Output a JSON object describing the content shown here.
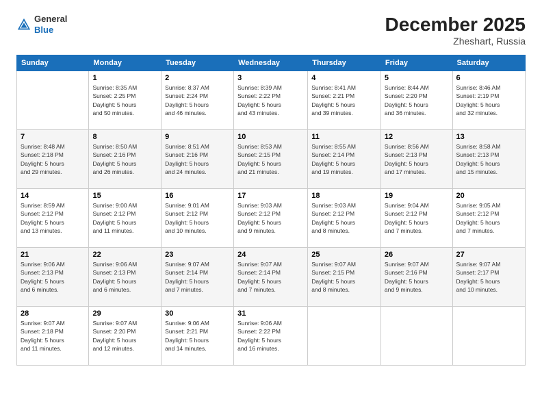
{
  "header": {
    "logo_general": "General",
    "logo_blue": "Blue",
    "month": "December 2025",
    "location": "Zheshart, Russia"
  },
  "days_of_week": [
    "Sunday",
    "Monday",
    "Tuesday",
    "Wednesday",
    "Thursday",
    "Friday",
    "Saturday"
  ],
  "weeks": [
    [
      {
        "day": "",
        "info": ""
      },
      {
        "day": "1",
        "info": "Sunrise: 8:35 AM\nSunset: 2:25 PM\nDaylight: 5 hours\nand 50 minutes."
      },
      {
        "day": "2",
        "info": "Sunrise: 8:37 AM\nSunset: 2:24 PM\nDaylight: 5 hours\nand 46 minutes."
      },
      {
        "day": "3",
        "info": "Sunrise: 8:39 AM\nSunset: 2:22 PM\nDaylight: 5 hours\nand 43 minutes."
      },
      {
        "day": "4",
        "info": "Sunrise: 8:41 AM\nSunset: 2:21 PM\nDaylight: 5 hours\nand 39 minutes."
      },
      {
        "day": "5",
        "info": "Sunrise: 8:44 AM\nSunset: 2:20 PM\nDaylight: 5 hours\nand 36 minutes."
      },
      {
        "day": "6",
        "info": "Sunrise: 8:46 AM\nSunset: 2:19 PM\nDaylight: 5 hours\nand 32 minutes."
      }
    ],
    [
      {
        "day": "7",
        "info": "Sunrise: 8:48 AM\nSunset: 2:18 PM\nDaylight: 5 hours\nand 29 minutes."
      },
      {
        "day": "8",
        "info": "Sunrise: 8:50 AM\nSunset: 2:16 PM\nDaylight: 5 hours\nand 26 minutes."
      },
      {
        "day": "9",
        "info": "Sunrise: 8:51 AM\nSunset: 2:16 PM\nDaylight: 5 hours\nand 24 minutes."
      },
      {
        "day": "10",
        "info": "Sunrise: 8:53 AM\nSunset: 2:15 PM\nDaylight: 5 hours\nand 21 minutes."
      },
      {
        "day": "11",
        "info": "Sunrise: 8:55 AM\nSunset: 2:14 PM\nDaylight: 5 hours\nand 19 minutes."
      },
      {
        "day": "12",
        "info": "Sunrise: 8:56 AM\nSunset: 2:13 PM\nDaylight: 5 hours\nand 17 minutes."
      },
      {
        "day": "13",
        "info": "Sunrise: 8:58 AM\nSunset: 2:13 PM\nDaylight: 5 hours\nand 15 minutes."
      }
    ],
    [
      {
        "day": "14",
        "info": "Sunrise: 8:59 AM\nSunset: 2:12 PM\nDaylight: 5 hours\nand 13 minutes."
      },
      {
        "day": "15",
        "info": "Sunrise: 9:00 AM\nSunset: 2:12 PM\nDaylight: 5 hours\nand 11 minutes."
      },
      {
        "day": "16",
        "info": "Sunrise: 9:01 AM\nSunset: 2:12 PM\nDaylight: 5 hours\nand 10 minutes."
      },
      {
        "day": "17",
        "info": "Sunrise: 9:03 AM\nSunset: 2:12 PM\nDaylight: 5 hours\nand 9 minutes."
      },
      {
        "day": "18",
        "info": "Sunrise: 9:03 AM\nSunset: 2:12 PM\nDaylight: 5 hours\nand 8 minutes."
      },
      {
        "day": "19",
        "info": "Sunrise: 9:04 AM\nSunset: 2:12 PM\nDaylight: 5 hours\nand 7 minutes."
      },
      {
        "day": "20",
        "info": "Sunrise: 9:05 AM\nSunset: 2:12 PM\nDaylight: 5 hours\nand 7 minutes."
      }
    ],
    [
      {
        "day": "21",
        "info": "Sunrise: 9:06 AM\nSunset: 2:13 PM\nDaylight: 5 hours\nand 6 minutes."
      },
      {
        "day": "22",
        "info": "Sunrise: 9:06 AM\nSunset: 2:13 PM\nDaylight: 5 hours\nand 6 minutes."
      },
      {
        "day": "23",
        "info": "Sunrise: 9:07 AM\nSunset: 2:14 PM\nDaylight: 5 hours\nand 7 minutes."
      },
      {
        "day": "24",
        "info": "Sunrise: 9:07 AM\nSunset: 2:14 PM\nDaylight: 5 hours\nand 7 minutes."
      },
      {
        "day": "25",
        "info": "Sunrise: 9:07 AM\nSunset: 2:15 PM\nDaylight: 5 hours\nand 8 minutes."
      },
      {
        "day": "26",
        "info": "Sunrise: 9:07 AM\nSunset: 2:16 PM\nDaylight: 5 hours\nand 9 minutes."
      },
      {
        "day": "27",
        "info": "Sunrise: 9:07 AM\nSunset: 2:17 PM\nDaylight: 5 hours\nand 10 minutes."
      }
    ],
    [
      {
        "day": "28",
        "info": "Sunrise: 9:07 AM\nSunset: 2:18 PM\nDaylight: 5 hours\nand 11 minutes."
      },
      {
        "day": "29",
        "info": "Sunrise: 9:07 AM\nSunset: 2:20 PM\nDaylight: 5 hours\nand 12 minutes."
      },
      {
        "day": "30",
        "info": "Sunrise: 9:06 AM\nSunset: 2:21 PM\nDaylight: 5 hours\nand 14 minutes."
      },
      {
        "day": "31",
        "info": "Sunrise: 9:06 AM\nSunset: 2:22 PM\nDaylight: 5 hours\nand 16 minutes."
      },
      {
        "day": "",
        "info": ""
      },
      {
        "day": "",
        "info": ""
      },
      {
        "day": "",
        "info": ""
      }
    ]
  ]
}
